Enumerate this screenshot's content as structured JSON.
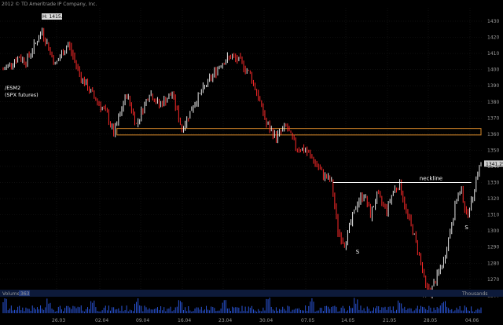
{
  "copyright": "2012 © TD Ameritrade IP Company, Inc.",
  "symbol": "/ESM2",
  "symbol_desc": "(SPX futures)",
  "volume_panel": {
    "label": "Volume",
    "value": "363",
    "units_label": "Thousands"
  },
  "colors": {
    "background": "#000000",
    "up": "#e8e8e8",
    "down": "#ff2a2a",
    "support_box": "#d98a2a",
    "neckline": "#ffffff",
    "volume": "#2a55d8",
    "grid": "#1e1e1e",
    "price_tag": "#cfcfcf"
  },
  "chart_data": {
    "type": "line",
    "title": "",
    "xlabel": "",
    "ylabel": "",
    "ylim": [
      1253,
      1435
    ],
    "y_ticks": [
      "1430",
      "1420",
      "1410",
      "1400",
      "1390",
      "1380",
      "1370",
      "1360",
      "1350",
      "1340",
      "1330",
      "1320",
      "1310",
      "1300",
      "1290",
      "1280",
      "1270",
      "1260"
    ],
    "x_ticks": [
      "26.03",
      "02.04",
      "09.04",
      "16.04",
      "23.04",
      "30.04",
      "07.05",
      "14.05",
      "21.05",
      "28.05",
      "04.06"
    ],
    "grid": true,
    "high_label": "H: 1415.25",
    "last_price_label": "1341.25",
    "price_path": [
      {
        "i": 0,
        "p": 1400
      },
      {
        "i": 10,
        "p": 1408
      },
      {
        "i": 14,
        "p": 1405
      },
      {
        "i": 24,
        "p": 1424
      },
      {
        "i": 32,
        "p": 1403
      },
      {
        "i": 40,
        "p": 1416
      },
      {
        "i": 48,
        "p": 1395
      },
      {
        "i": 56,
        "p": 1383
      },
      {
        "i": 64,
        "p": 1372
      },
      {
        "i": 68,
        "p": 1360
      },
      {
        "i": 76,
        "p": 1385
      },
      {
        "i": 82,
        "p": 1366
      },
      {
        "i": 90,
        "p": 1386
      },
      {
        "i": 96,
        "p": 1378
      },
      {
        "i": 104,
        "p": 1385
      },
      {
        "i": 110,
        "p": 1363
      },
      {
        "i": 118,
        "p": 1380
      },
      {
        "i": 126,
        "p": 1392
      },
      {
        "i": 134,
        "p": 1404
      },
      {
        "i": 140,
        "p": 1408
      },
      {
        "i": 146,
        "p": 1405
      },
      {
        "i": 152,
        "p": 1397
      },
      {
        "i": 158,
        "p": 1380
      },
      {
        "i": 162,
        "p": 1366
      },
      {
        "i": 168,
        "p": 1358
      },
      {
        "i": 174,
        "p": 1365
      },
      {
        "i": 180,
        "p": 1352
      },
      {
        "i": 186,
        "p": 1350
      },
      {
        "i": 190,
        "p": 1345
      },
      {
        "i": 196,
        "p": 1336
      },
      {
        "i": 202,
        "p": 1330
      },
      {
        "i": 206,
        "p": 1300
      },
      {
        "i": 210,
        "p": 1292
      },
      {
        "i": 214,
        "p": 1305
      },
      {
        "i": 218,
        "p": 1318
      },
      {
        "i": 222,
        "p": 1323
      },
      {
        "i": 226,
        "p": 1310
      },
      {
        "i": 230,
        "p": 1322
      },
      {
        "i": 236,
        "p": 1313
      },
      {
        "i": 240,
        "p": 1325
      },
      {
        "i": 244,
        "p": 1329
      },
      {
        "i": 248,
        "p": 1312
      },
      {
        "i": 252,
        "p": 1300
      },
      {
        "i": 256,
        "p": 1285
      },
      {
        "i": 260,
        "p": 1265
      },
      {
        "i": 263,
        "p": 1262
      },
      {
        "i": 267,
        "p": 1272
      },
      {
        "i": 271,
        "p": 1281
      },
      {
        "i": 275,
        "p": 1300
      },
      {
        "i": 279,
        "p": 1320
      },
      {
        "i": 282,
        "p": 1325
      },
      {
        "i": 285,
        "p": 1310
      },
      {
        "i": 288,
        "p": 1317
      },
      {
        "i": 291,
        "p": 1333
      },
      {
        "i": 294,
        "p": 1342
      }
    ],
    "total_bars": 295,
    "support_zone": {
      "top": 1363.5,
      "bottom": 1359.5,
      "bar_start": 70,
      "bar_end": 294
    },
    "neckline": {
      "price": 1330,
      "bar_start": 203,
      "bar_end": 288,
      "label": "neckline"
    },
    "pattern_labels": [
      {
        "text": "S",
        "bar": 217,
        "price": 1286
      },
      {
        "text": "H",
        "bar": 258,
        "price": 1259
      },
      {
        "text": "S",
        "bar": 284,
        "price": 1301
      }
    ]
  }
}
